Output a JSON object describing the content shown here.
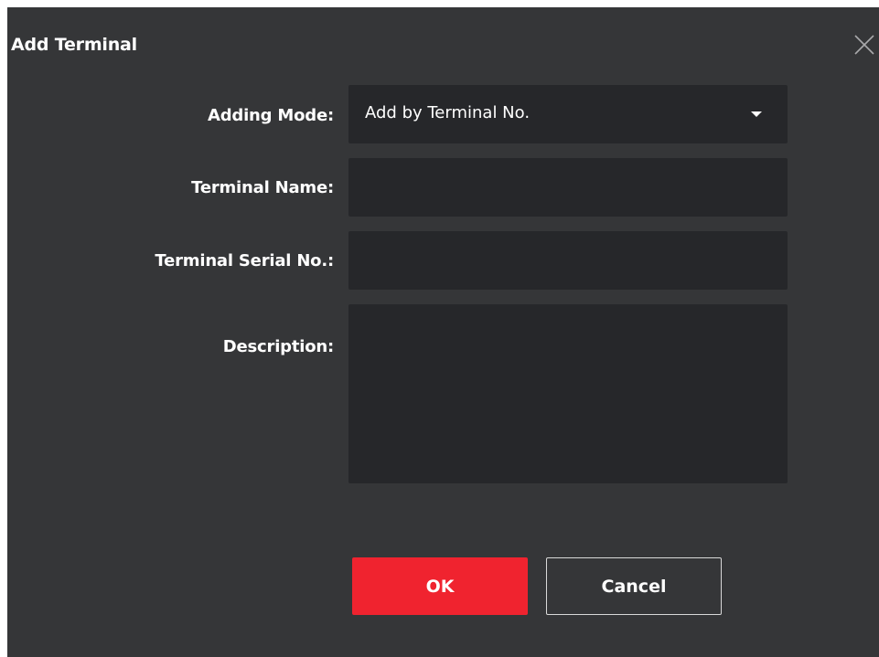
{
  "dialog": {
    "title": "Add Terminal",
    "close_icon": "close-icon"
  },
  "form": {
    "adding_mode": {
      "label": "Adding Mode:",
      "value": "Add by Terminal No.",
      "icon": "chevron-down-icon"
    },
    "terminal_name": {
      "label": "Terminal Name:",
      "value": ""
    },
    "terminal_serial_no": {
      "label": "Terminal Serial No.:",
      "value": ""
    },
    "description": {
      "label": "Description:",
      "value": ""
    }
  },
  "buttons": {
    "ok_label": "OK",
    "cancel_label": "Cancel"
  },
  "colors": {
    "dialog_bg": "#353638",
    "field_bg": "#26272a",
    "ok_button": "#f0232f",
    "text": "#ffffff"
  }
}
